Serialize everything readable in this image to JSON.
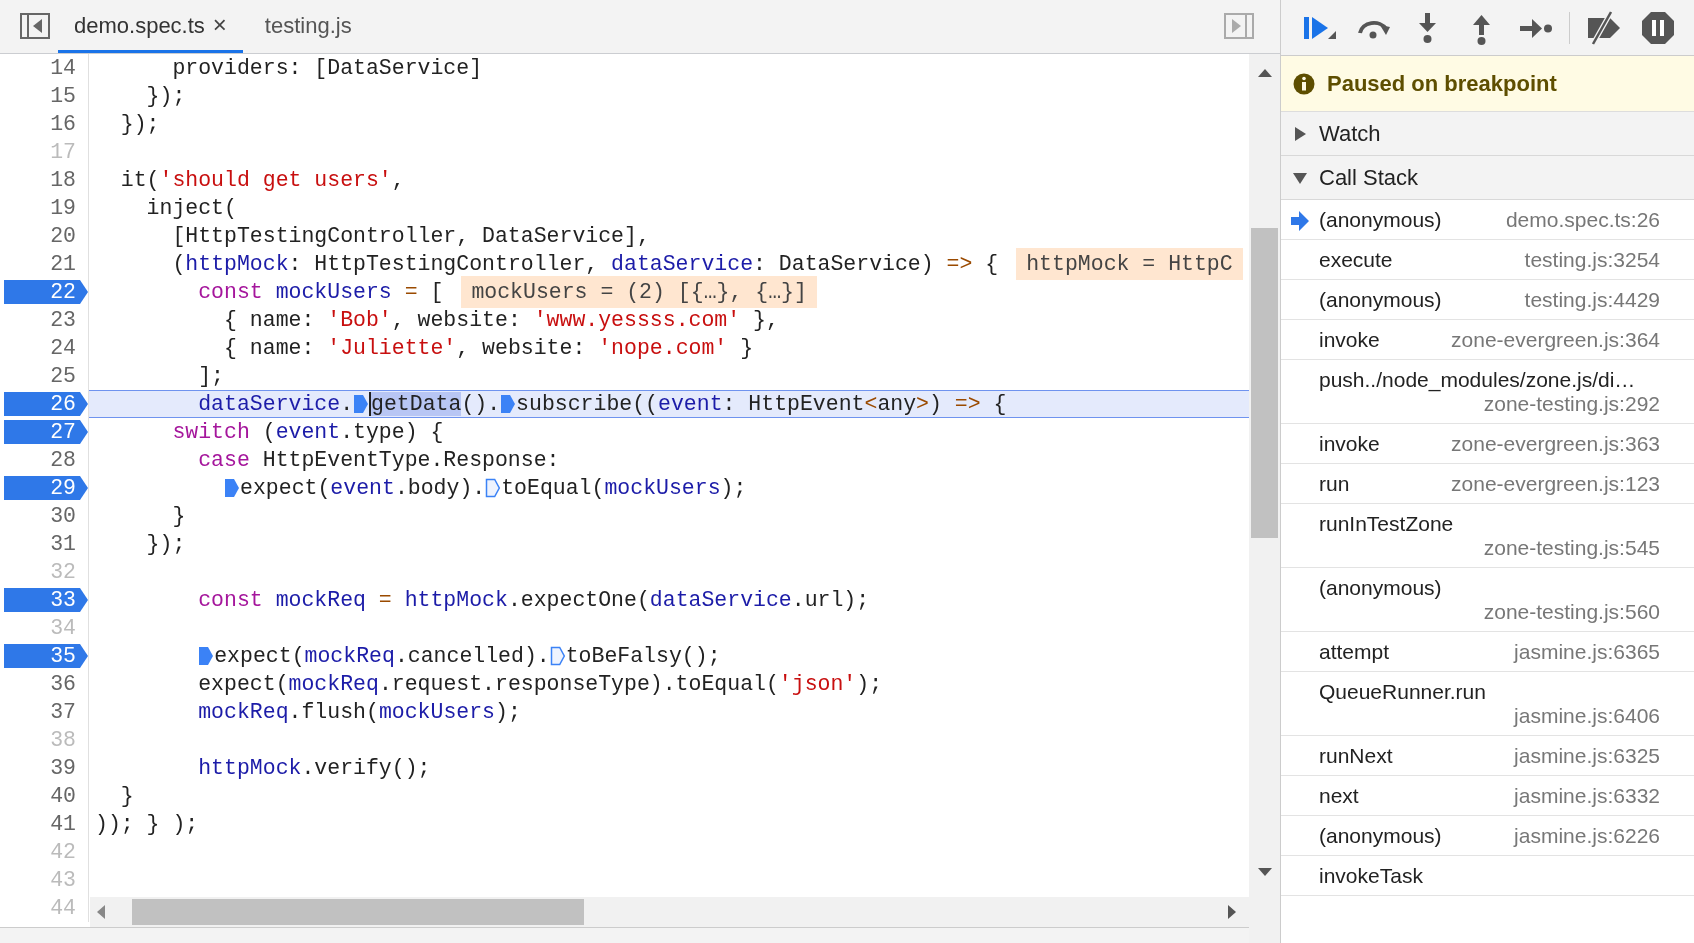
{
  "editor": {
    "tabs": [
      {
        "label": "demo.spec.ts",
        "selected": true,
        "close": "×"
      },
      {
        "label": "testing.js",
        "selected": false
      }
    ],
    "lines": [
      {
        "number": "14",
        "breakpoint": false,
        "current": false,
        "tokens": [
          {
            "kind": "plain",
            "text": "      providers: [DataService]"
          }
        ]
      },
      {
        "number": "15",
        "breakpoint": false,
        "current": false,
        "tokens": [
          {
            "kind": "plain",
            "text": "    });"
          }
        ]
      },
      {
        "number": "16",
        "breakpoint": false,
        "current": false,
        "tokens": [
          {
            "kind": "plain",
            "text": "  });"
          }
        ]
      },
      {
        "number": "17",
        "breakpoint": false,
        "current": false
      },
      {
        "number": "18",
        "breakpoint": false,
        "current": false,
        "tokens": [
          {
            "kind": "plain",
            "text": "  it("
          },
          {
            "kind": "string",
            "text": "'should get users'"
          },
          {
            "kind": "plain",
            "text": ","
          }
        ]
      },
      {
        "number": "19",
        "breakpoint": false,
        "current": false,
        "tokens": [
          {
            "kind": "plain",
            "text": "    inject("
          }
        ]
      },
      {
        "number": "20",
        "breakpoint": false,
        "current": false,
        "tokens": [
          {
            "kind": "plain",
            "text": "      [HttpTestingController, DataService],"
          }
        ]
      },
      {
        "number": "21",
        "breakpoint": false,
        "current": false,
        "tokens": [
          {
            "kind": "plain",
            "text": "      ("
          },
          {
            "kind": "variable",
            "text": "httpMock"
          },
          {
            "kind": "plain",
            "text": ": HttpTestingController, "
          },
          {
            "kind": "variable",
            "text": "dataService"
          },
          {
            "kind": "plain",
            "text": ": DataService) "
          },
          {
            "kind": "operator",
            "text": "=>"
          },
          {
            "kind": "plain",
            "text": " {"
          },
          {
            "kind": "inline-value",
            "text": "httpMock = HttpC"
          }
        ]
      },
      {
        "number": "22",
        "breakpoint": true,
        "current": false,
        "tokens": [
          {
            "kind": "keyword",
            "text": "        const"
          },
          {
            "kind": "variable",
            "text": " mockUsers"
          },
          {
            "kind": "operator",
            "text": " ="
          },
          {
            "kind": "plain",
            "text": " ["
          },
          {
            "kind": "inline-value",
            "text": "mockUsers = (2) [{…}, {…}]"
          }
        ]
      },
      {
        "number": "23",
        "breakpoint": false,
        "current": false,
        "tokens": [
          {
            "kind": "plain",
            "text": "          { name: "
          },
          {
            "kind": "string",
            "text": "'Bob'"
          },
          {
            "kind": "plain",
            "text": ", website: "
          },
          {
            "kind": "string",
            "text": "'www.yessss.com'"
          },
          {
            "kind": "plain",
            "text": " },"
          }
        ]
      },
      {
        "number": "24",
        "breakpoint": false,
        "current": false,
        "tokens": [
          {
            "kind": "plain",
            "text": "          { name: "
          },
          {
            "kind": "string",
            "text": "'Juliette'"
          },
          {
            "kind": "plain",
            "text": ", website: "
          },
          {
            "kind": "string",
            "text": "'nope.com'"
          },
          {
            "kind": "plain",
            "text": " }"
          }
        ]
      },
      {
        "number": "25",
        "breakpoint": false,
        "current": false,
        "tokens": [
          {
            "kind": "plain",
            "text": "        ];"
          }
        ]
      },
      {
        "number": "26",
        "breakpoint": true,
        "current": true,
        "tokens": [
          {
            "kind": "variable",
            "text": "        dataService"
          },
          {
            "kind": "plain",
            "text": "."
          },
          {
            "kind": "call",
            "text": "getData",
            "marker_active": true
          },
          {
            "kind": "plain",
            "text": "()."
          },
          {
            "kind": "plain",
            "text": "subscribe((",
            "marker_active": true
          },
          {
            "kind": "variable",
            "text": "event"
          },
          {
            "kind": "plain",
            "text": ": HttpEvent"
          },
          {
            "kind": "operator",
            "text": "<"
          },
          {
            "kind": "plain",
            "text": "any"
          },
          {
            "kind": "operator",
            "text": ">"
          },
          {
            "kind": "plain",
            "text": ") "
          },
          {
            "kind": "operator",
            "text": "=>"
          },
          {
            "kind": "plain",
            "text": " {"
          }
        ]
      },
      {
        "number": "27",
        "breakpoint": true,
        "current": false,
        "tokens": [
          {
            "kind": "keyword",
            "text": "      switch"
          },
          {
            "kind": "plain",
            "text": " ("
          },
          {
            "kind": "variable",
            "text": "event"
          },
          {
            "kind": "plain",
            "text": ".type) {"
          }
        ]
      },
      {
        "number": "28",
        "breakpoint": false,
        "current": false,
        "tokens": [
          {
            "kind": "keyword",
            "text": "        case"
          },
          {
            "kind": "plain",
            "text": " HttpEventType.Response:"
          }
        ]
      },
      {
        "number": "29",
        "breakpoint": true,
        "current": false,
        "tokens": [
          {
            "kind": "plain",
            "text": "          expect(",
            "marker_active": true
          },
          {
            "kind": "variable",
            "text": "event"
          },
          {
            "kind": "plain",
            "text": ".body)."
          },
          {
            "kind": "plain",
            "text": "toEqual(",
            "marker_active": false
          },
          {
            "kind": "variable",
            "text": "mockUsers"
          },
          {
            "kind": "plain",
            "text": ");"
          }
        ]
      },
      {
        "number": "30",
        "breakpoint": false,
        "current": false,
        "tokens": [
          {
            "kind": "plain",
            "text": "      }"
          }
        ]
      },
      {
        "number": "31",
        "breakpoint": false,
        "current": false,
        "tokens": [
          {
            "kind": "plain",
            "text": "    });"
          }
        ]
      },
      {
        "number": "32",
        "breakpoint": false,
        "current": false
      },
      {
        "number": "33",
        "breakpoint": true,
        "current": false,
        "tokens": [
          {
            "kind": "keyword",
            "text": "        const"
          },
          {
            "kind": "variable",
            "text": " mockReq"
          },
          {
            "kind": "operator",
            "text": " ="
          },
          {
            "kind": "variable",
            "text": " httpMock"
          },
          {
            "kind": "plain",
            "text": ".expectOne("
          },
          {
            "kind": "variable",
            "text": "dataService"
          },
          {
            "kind": "plain",
            "text": ".url);"
          }
        ]
      },
      {
        "number": "34",
        "breakpoint": false,
        "current": false
      },
      {
        "number": "35",
        "breakpoint": true,
        "current": false,
        "tokens": [
          {
            "kind": "plain",
            "text": "        expect(",
            "marker_active": true
          },
          {
            "kind": "variable",
            "text": "mockReq"
          },
          {
            "kind": "plain",
            "text": ".cancelled)."
          },
          {
            "kind": "plain",
            "text": "toBeFalsy();",
            "marker_active": false
          }
        ]
      },
      {
        "number": "36",
        "breakpoint": false,
        "current": false,
        "tokens": [
          {
            "kind": "plain",
            "text": "        expect("
          },
          {
            "kind": "variable",
            "text": "mockReq"
          },
          {
            "kind": "plain",
            "text": ".request.responseType).toEqual("
          },
          {
            "kind": "string",
            "text": "'json'"
          },
          {
            "kind": "plain",
            "text": ");"
          }
        ]
      },
      {
        "number": "37",
        "breakpoint": false,
        "current": false,
        "tokens": [
          {
            "kind": "variable",
            "text": "        mockReq"
          },
          {
            "kind": "plain",
            "text": ".flush("
          },
          {
            "kind": "variable",
            "text": "mockUsers"
          },
          {
            "kind": "plain",
            "text": ");"
          }
        ]
      },
      {
        "number": "38",
        "breakpoint": false,
        "current": false
      },
      {
        "number": "39",
        "breakpoint": false,
        "current": false,
        "tokens": [
          {
            "kind": "variable",
            "text": "        httpMock"
          },
          {
            "kind": "plain",
            "text": ".verify();"
          }
        ]
      },
      {
        "number": "40",
        "breakpoint": false,
        "current": false,
        "tokens": [
          {
            "kind": "plain",
            "text": "  }"
          }
        ]
      },
      {
        "number": "41",
        "breakpoint": false,
        "current": false,
        "tokens": [
          {
            "kind": "plain",
            "text": ")); } );"
          }
        ]
      },
      {
        "number": "42",
        "breakpoint": false,
        "current": false
      },
      {
        "number": "43",
        "breakpoint": false,
        "current": false
      },
      {
        "number": "44",
        "breakpoint": false,
        "current": false
      }
    ]
  },
  "debugger": {
    "status": "Paused on breakpoint",
    "sections": [
      {
        "title": "Watch",
        "expanded": false
      },
      {
        "title": "Call Stack",
        "expanded": true,
        "frames": [
          {
            "name": "(anonymous)",
            "location": "demo.spec.ts:26",
            "selected": true,
            "kind": "inline"
          },
          {
            "name": "execute",
            "location": "testing.js:3254",
            "selected": false,
            "kind": "inline"
          },
          {
            "name": "(anonymous)",
            "location": "testing.js:4429",
            "selected": false,
            "kind": "inline"
          },
          {
            "name": "invoke",
            "location": "zone-evergreen.js:364",
            "selected": false,
            "kind": "inline"
          },
          {
            "name": "push../node_modules/zone.js/di…",
            "location": "zone-testing.js:292",
            "selected": false,
            "kind": "stacked"
          },
          {
            "name": "invoke",
            "location": "zone-evergreen.js:363",
            "selected": false,
            "kind": "inline"
          },
          {
            "name": "run",
            "location": "zone-evergreen.js:123",
            "selected": false,
            "kind": "inline"
          },
          {
            "name": "runInTestZone",
            "location": "zone-testing.js:545",
            "selected": false,
            "kind": "stacked"
          },
          {
            "name": "(anonymous)",
            "location": "zone-testing.js:560",
            "selected": false,
            "kind": "stacked"
          },
          {
            "name": "attempt",
            "location": "jasmine.js:6365",
            "selected": false,
            "kind": "inline"
          },
          {
            "name": "QueueRunner.run",
            "location": "jasmine.js:6406",
            "selected": false,
            "kind": "stacked"
          },
          {
            "name": "runNext",
            "location": "jasmine.js:6325",
            "selected": false,
            "kind": "inline"
          },
          {
            "name": "next",
            "location": "jasmine.js:6332",
            "selected": false,
            "kind": "inline"
          },
          {
            "name": "(anonymous)",
            "location": "jasmine.js:6226",
            "selected": false,
            "kind": "inline"
          },
          {
            "name": "invokeTask",
            "selected": false,
            "kind": "inline"
          }
        ]
      }
    ]
  }
}
